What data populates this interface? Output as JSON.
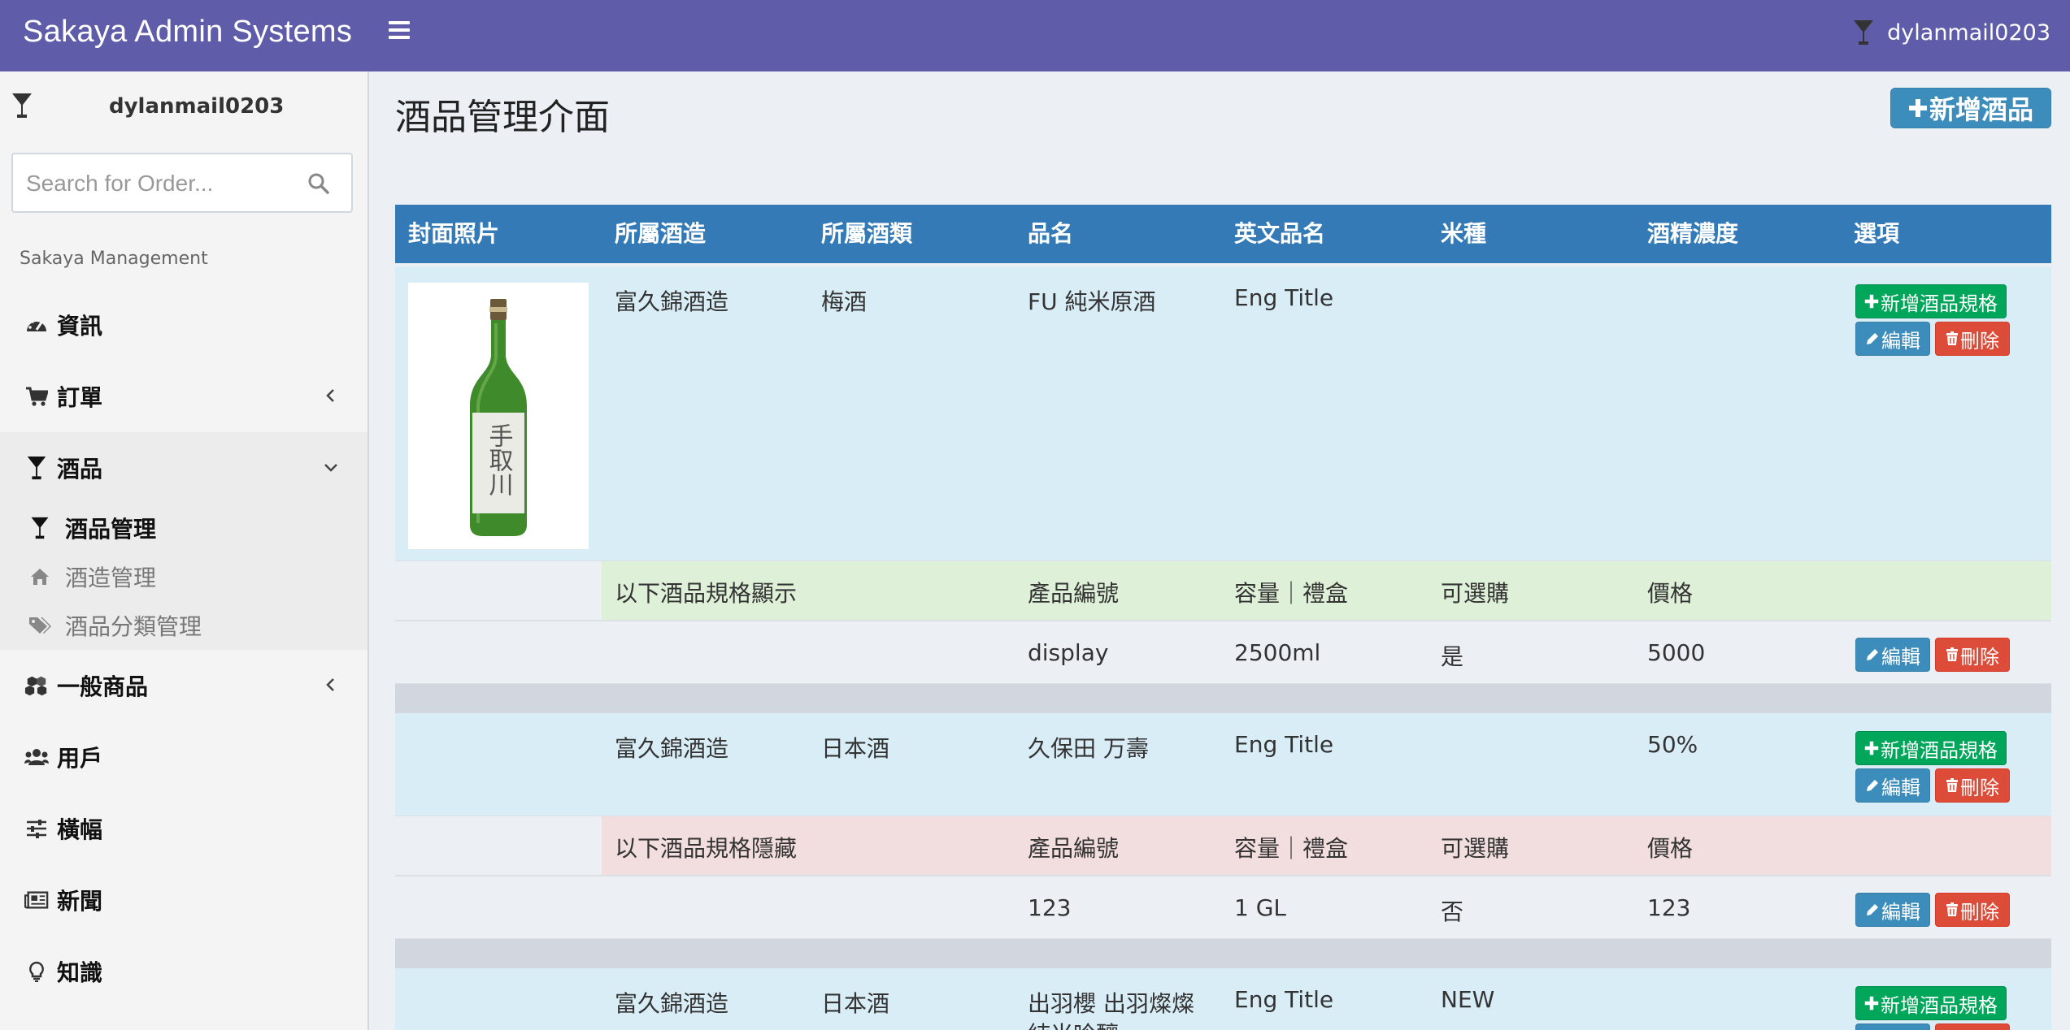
{
  "header": {
    "brand": "Sakaya Admin Systems",
    "user": "dylanmail0203"
  },
  "sidebar": {
    "user_name": "dylanmail0203",
    "search_placeholder": "Search for Order...",
    "section_header": "Sakaya Management",
    "items": [
      {
        "label": "資訊",
        "icon": "dashboard-icon"
      },
      {
        "label": "訂單",
        "icon": "cart-icon"
      },
      {
        "label": "酒品",
        "icon": "glass-icon"
      },
      {
        "label": "一般商品",
        "icon": "cubes-icon"
      },
      {
        "label": "用戶",
        "icon": "users-icon"
      },
      {
        "label": "橫幅",
        "icon": "sliders-icon"
      },
      {
        "label": "新聞",
        "icon": "newspaper-icon"
      },
      {
        "label": "知識",
        "icon": "lightbulb-icon"
      }
    ],
    "subitems": [
      {
        "label": "酒品管理",
        "icon": "glass-icon",
        "active": true
      },
      {
        "label": "酒造管理",
        "icon": "home-icon",
        "active": false
      },
      {
        "label": "酒品分類管理",
        "icon": "tags-icon",
        "active": false
      }
    ]
  },
  "page": {
    "title": "酒品管理介面",
    "add_button": "新增酒品"
  },
  "table": {
    "headers": [
      "封面照片",
      "所屬酒造",
      "所屬酒類",
      "品名",
      "英文品名",
      "米種",
      "酒精濃度",
      "選項"
    ],
    "spec_headers": {
      "code": "產品編號",
      "volume": "容量｜禮盒",
      "available": "可選購",
      "price": "價格"
    },
    "buttons": {
      "add_spec": "新增酒品規格",
      "edit": "編輯",
      "delete": "刪除"
    },
    "products": [
      {
        "brewery": "富久錦酒造",
        "category": "梅酒",
        "name": "FU 純米原酒",
        "eng_name": "Eng Title",
        "rice": "",
        "abv": "",
        "has_photo": true,
        "photo_label": "手取川",
        "spec_caption": "以下酒品規格顯示",
        "spec_visible": true,
        "specs": [
          {
            "code": "display",
            "volume": "2500ml",
            "available": "是",
            "price": "5000"
          }
        ]
      },
      {
        "brewery": "富久錦酒造",
        "category": "日本酒",
        "name": "久保田 万壽",
        "eng_name": "Eng Title",
        "rice": "",
        "abv": "50%",
        "has_photo": false,
        "spec_caption": "以下酒品規格隱藏",
        "spec_visible": false,
        "specs": [
          {
            "code": "123",
            "volume": "1 GL",
            "available": "否",
            "price": "123"
          }
        ]
      },
      {
        "brewery": "富久錦酒造",
        "category": "日本酒",
        "name": "出羽櫻 出羽燦燦",
        "name_line2": "純米吟釀",
        "eng_name": "Eng Title",
        "rice": "NEW",
        "abv": "",
        "has_photo": false
      }
    ]
  },
  "colors": {
    "navbar": "#5f5ca9",
    "table_header": "#337ab7",
    "row_info": "#d9edf7",
    "row_success": "#dff0d8",
    "row_danger": "#f2dede",
    "btn_green": "#00a65a",
    "btn_blue": "#3c8dbc",
    "btn_red": "#dd4b39"
  }
}
